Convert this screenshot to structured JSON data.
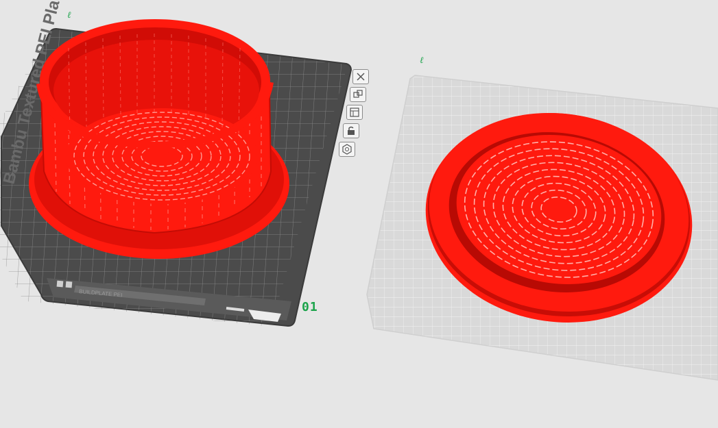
{
  "plates": [
    {
      "number_label": "01",
      "edit_glyph": "ℓ",
      "bed_text": "Bambu Textured PEI Plate",
      "label_strip_text": "BUILDPLATE PEI",
      "tools": [
        {
          "name": "close-plate-icon"
        },
        {
          "name": "arrange-icon"
        },
        {
          "name": "plate-settings-icon"
        },
        {
          "name": "lock-icon"
        },
        {
          "name": "orient-icon"
        }
      ]
    },
    {
      "edit_glyph": "ℓ"
    }
  ],
  "colors": {
    "background": "#e6e6e6",
    "active_bed": "#4b4b4b",
    "inactive_bed": "#d9d9d9",
    "model": "#ff1a0e",
    "plate_number": "#1aa34a"
  }
}
